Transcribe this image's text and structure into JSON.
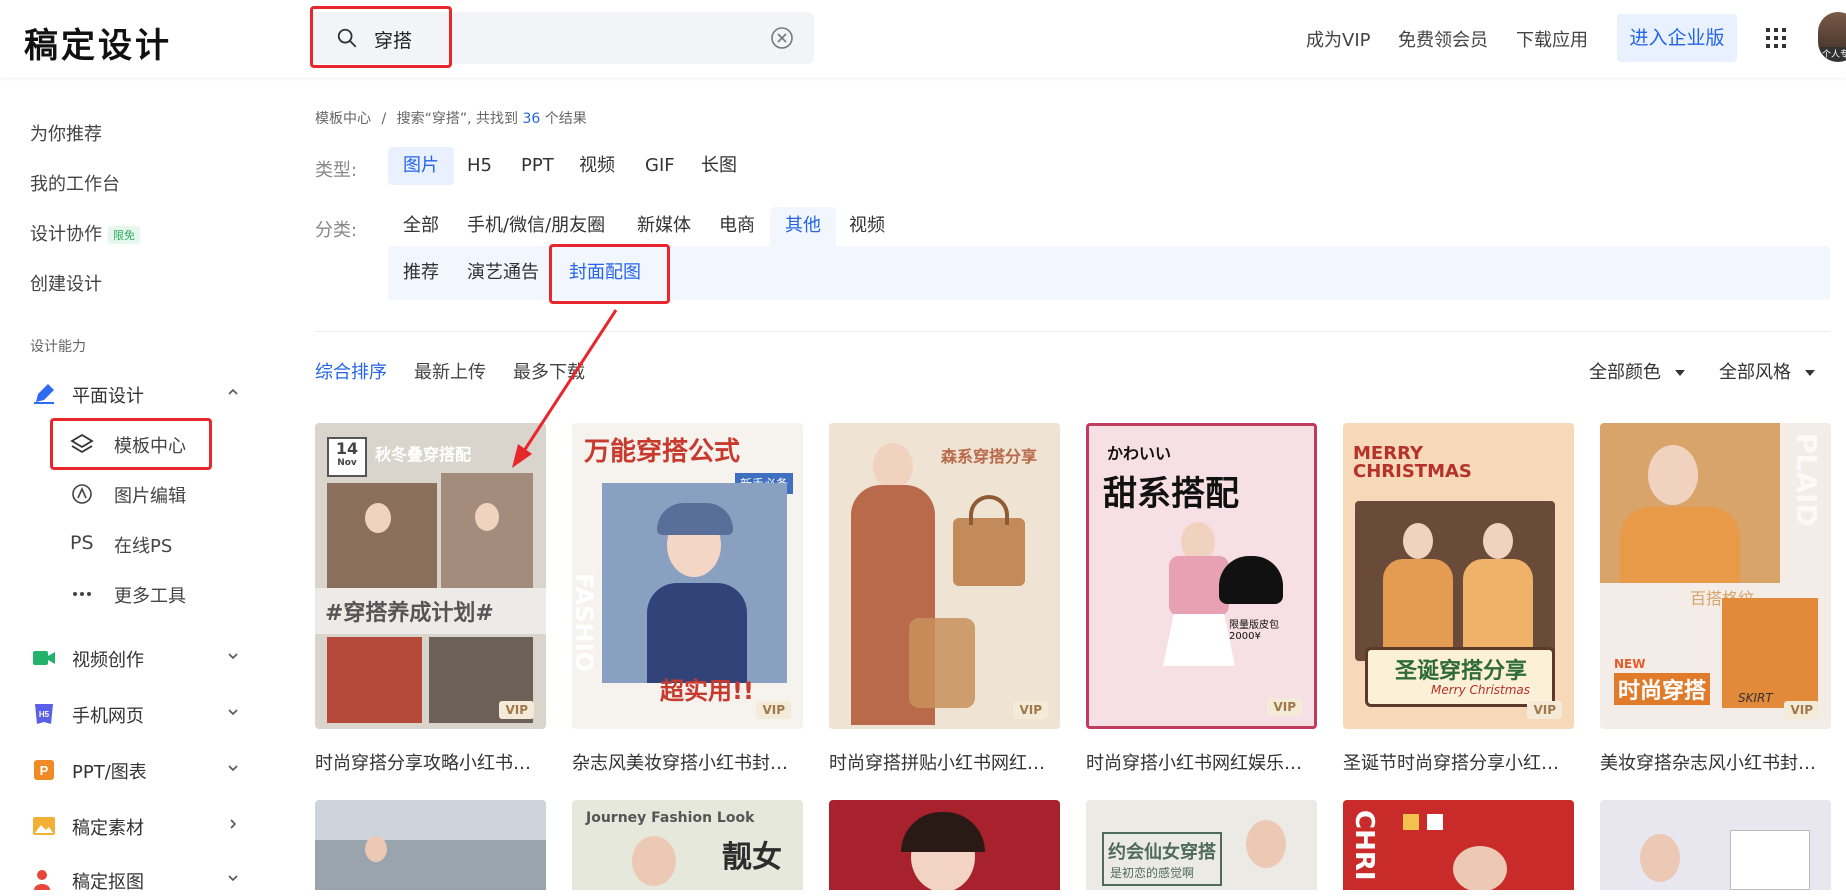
{
  "header": {
    "logo": "稿定设计",
    "search_query": "穿搭",
    "links": [
      "成为VIP",
      "免费领会员",
      "下载应用"
    ],
    "enterprise_button": "进入企业版",
    "avatar_tag": "个人专"
  },
  "sidebar": {
    "top_items": [
      "为你推荐",
      "我的工作台",
      "设计协作",
      "创建设计"
    ],
    "collab_badge": "限免",
    "section_label": "设计能力",
    "groups": [
      {
        "label": "平面设计",
        "icon": "pen-icon",
        "color": "#2f6bf0",
        "expanded": true
      },
      {
        "label": "视频创作",
        "icon": "video-icon",
        "color": "#22b26b"
      },
      {
        "label": "手机网页",
        "icon": "h5-icon",
        "color": "#5b5fe6"
      },
      {
        "label": "PPT/图表",
        "icon": "ppt-icon",
        "color": "#f08a24"
      },
      {
        "label": "稿定素材",
        "icon": "material-icon",
        "color": "#f2b035"
      },
      {
        "label": "稿定抠图",
        "icon": "cutout-icon",
        "color": "#e8463a"
      }
    ],
    "sub_items": [
      "模板中心",
      "图片编辑",
      "在线PS",
      "更多工具"
    ],
    "ps_glyph": "PS"
  },
  "breadcrumb": {
    "root": "模板中心",
    "sep": "/",
    "prefix": "搜索“穿搭”, 共找到",
    "count": "36",
    "suffix": "个结果"
  },
  "filters": {
    "type_label": "类型:",
    "types": [
      "图片",
      "H5",
      "PPT",
      "视频",
      "GIF",
      "长图"
    ],
    "category_label": "分类:",
    "categories": [
      "全部",
      "手机/微信/朋友圈",
      "新媒体",
      "电商",
      "其他",
      "视频"
    ],
    "subcategories": [
      "推荐",
      "演艺通告",
      "封面配图"
    ]
  },
  "sort": {
    "options": [
      "综合排序",
      "最新上传",
      "最多下载"
    ],
    "color_filter": "全部颜色",
    "style_filter": "全部风格"
  },
  "cards": [
    {
      "caption": "时尚穿搭分享攻略小红书封...",
      "t1": "秋冬叠穿搭配",
      "t2": "#穿搭养成计划#",
      "date": "14",
      "month": "Nov",
      "bg": "#d9d4cc",
      "accent": "#5a5a5a",
      "vip": "VIP"
    },
    {
      "caption": "杂志风美妆穿搭小红书封面...",
      "t1": "万能穿搭公式",
      "t2": "超实用!!",
      "tag": "新手必备",
      "side": "FASHIO",
      "bg": "#f6f2ee",
      "accent": "#c83a2e",
      "vip": "VIP"
    },
    {
      "caption": "时尚穿搭拼贴小红书网红娱...",
      "t1": "森系穿搭分享",
      "bg": "#efe3d4",
      "accent": "#b86a4a",
      "vip": "VIP"
    },
    {
      "caption": "时尚穿搭小红书网红娱乐封...",
      "t1": "かわいい",
      "t2": "甜系搭配",
      "note": "限量版皮包 2000¥",
      "bg": "#f7dfe6",
      "accent": "#c23b5c",
      "vip": "VIP"
    },
    {
      "caption": "圣诞节时尚穿搭分享小红书...",
      "t1": "MERRY CHRISTMAS",
      "t2": "圣诞穿搭分享",
      "t3": "Merry Christmas",
      "bg": "#f7d8b8",
      "accent": "#b5322a",
      "vip": "VIP"
    },
    {
      "caption": "美妆穿搭杂志风小红书封面...",
      "t1": "百搭格纹",
      "t2": "时尚穿搭",
      "t3": "NEW",
      "t4": "SKIRT",
      "bg": "#f4ece6",
      "accent": "#d8a46a",
      "vip": "VIP"
    }
  ],
  "cards_row2": [
    {
      "t1": "",
      "bg": "#cdd4dc"
    },
    {
      "t1": "Journey Fashion Look",
      "t2": "靓女",
      "bg": "#e6e8dc"
    },
    {
      "t1": "",
      "bg": "#a8222e"
    },
    {
      "t1": "约会仙女穿搭",
      "t2": "是初恋的感觉啊",
      "bg": "#eceae4"
    },
    {
      "t1": "CHRI",
      "bg": "#c92b2b"
    },
    {
      "t1": "",
      "bg": "#e8e6ee"
    }
  ]
}
